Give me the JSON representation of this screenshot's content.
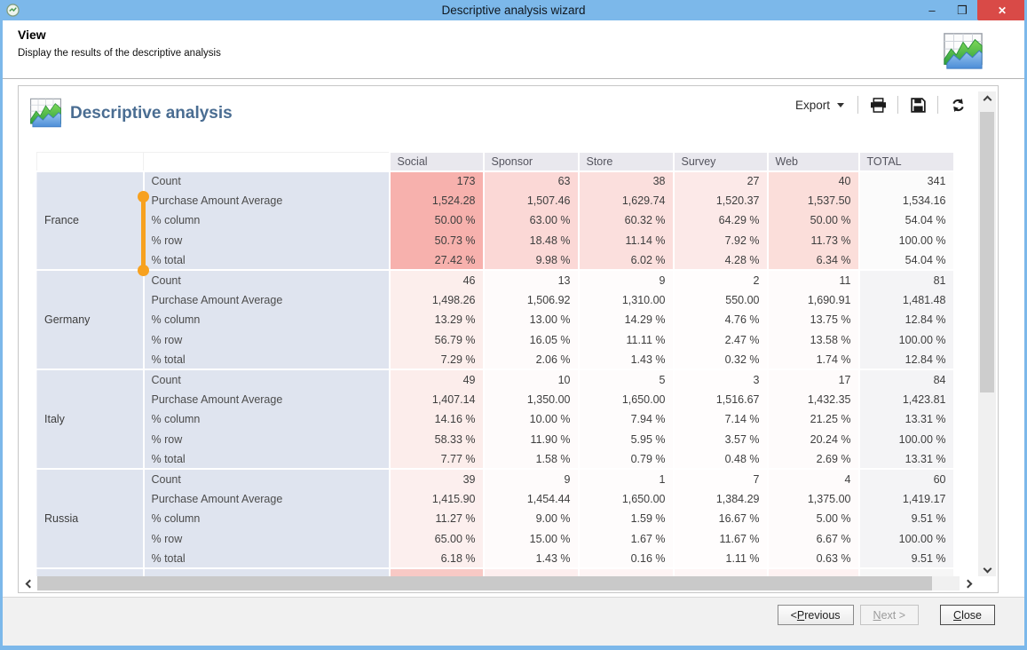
{
  "window": {
    "title": "Descriptive analysis wizard",
    "minimize_glyph": "–",
    "maximize_glyph": "❒",
    "close_glyph": "✕"
  },
  "header": {
    "title": "View",
    "subtitle": "Display the results of the descriptive analysis"
  },
  "panel": {
    "title": "Descriptive analysis",
    "toolbar": {
      "export_label": "Export"
    }
  },
  "icons": {
    "app": "chart-table-icon",
    "toolbar": [
      "export-caret-icon",
      "printer-icon",
      "save-icon",
      "refresh-icon"
    ]
  },
  "colors": {
    "titlebar": "#7cb8ea",
    "close_button": "#d94a47",
    "heading": "#4a6d92",
    "header_cell_bg": "#e9e8ee",
    "row_label_bg": "#dfe4ef",
    "marker_orange": "#f7a11f",
    "footer_bg": "#f1f1f1"
  },
  "table": {
    "column_headers": [
      "Social",
      "Sponsor",
      "Store",
      "Survey",
      "Web",
      "TOTAL"
    ],
    "metric_labels": [
      "Count",
      "Purchase Amount Average",
      "% column",
      "% row",
      "% total"
    ],
    "blocks": [
      {
        "country": "France",
        "tints": [
          "#f7b1ad",
          "#fbd8d6",
          "#fbdfdd",
          "#fce9e8",
          "#fbdeda",
          "#fbfbfb"
        ],
        "rows": [
          {
            "label": "Count",
            "values": [
              "173",
              "63",
              "38",
              "27",
              "40",
              "341"
            ]
          },
          {
            "label": "Purchase Amount Average",
            "values": [
              "1,524.28",
              "1,507.46",
              "1,629.74",
              "1,520.37",
              "1,537.50",
              "1,534.16"
            ]
          },
          {
            "label": "% column",
            "values": [
              "50.00 %",
              "63.00 %",
              "60.32 %",
              "64.29 %",
              "50.00 %",
              "54.04 %"
            ]
          },
          {
            "label": "% row",
            "values": [
              "50.73 %",
              "18.48 %",
              "11.14 %",
              "7.92 %",
              "11.73 %",
              "100.00 %"
            ]
          },
          {
            "label": "% total",
            "values": [
              "27.42 %",
              "9.98 %",
              "6.02 %",
              "4.28 %",
              "6.34 %",
              "54.04 %"
            ]
          }
        ]
      },
      {
        "country": "Germany",
        "tints": [
          "#fceeec",
          "#fefbfb",
          "#fefcfc",
          "#fffdfd",
          "#fefbfb",
          "#f4f4f6"
        ],
        "rows": [
          {
            "label": "Count",
            "values": [
              "46",
              "13",
              "9",
              "2",
              "11",
              "81"
            ]
          },
          {
            "label": "Purchase Amount Average",
            "values": [
              "1,498.26",
              "1,506.92",
              "1,310.00",
              "550.00",
              "1,690.91",
              "1,481.48"
            ]
          },
          {
            "label": "% column",
            "values": [
              "13.29 %",
              "13.00 %",
              "14.29 %",
              "4.76 %",
              "13.75 %",
              "12.84 %"
            ]
          },
          {
            "label": "% row",
            "values": [
              "56.79 %",
              "16.05 %",
              "11.11 %",
              "2.47 %",
              "13.58 %",
              "100.00 %"
            ]
          },
          {
            "label": "% total",
            "values": [
              "7.29 %",
              "2.06 %",
              "1.43 %",
              "0.32 %",
              "1.74 %",
              "12.84 %"
            ]
          }
        ]
      },
      {
        "country": "Italy",
        "tints": [
          "#fcedeb",
          "#fefbfb",
          "#fefcfc",
          "#fffdfd",
          "#fefbfb",
          "#f4f4f6"
        ],
        "rows": [
          {
            "label": "Count",
            "values": [
              "49",
              "10",
              "5",
              "3",
              "17",
              "84"
            ]
          },
          {
            "label": "Purchase Amount Average",
            "values": [
              "1,407.14",
              "1,350.00",
              "1,650.00",
              "1,516.67",
              "1,432.35",
              "1,423.81"
            ]
          },
          {
            "label": "% column",
            "values": [
              "14.16 %",
              "10.00 %",
              "7.94 %",
              "7.14 %",
              "21.25 %",
              "13.31 %"
            ]
          },
          {
            "label": "% row",
            "values": [
              "58.33 %",
              "11.90 %",
              "5.95 %",
              "3.57 %",
              "20.24 %",
              "100.00 %"
            ]
          },
          {
            "label": "% total",
            "values": [
              "7.77 %",
              "1.58 %",
              "0.79 %",
              "0.48 %",
              "2.69 %",
              "13.31 %"
            ]
          }
        ]
      },
      {
        "country": "Russia",
        "tints": [
          "#fcefee",
          "#fefbfb",
          "#fefcfc",
          "#fffdfd",
          "#fefbfb",
          "#f4f4f6"
        ],
        "rows": [
          {
            "label": "Count",
            "values": [
              "39",
              "9",
              "1",
              "7",
              "4",
              "60"
            ]
          },
          {
            "label": "Purchase Amount Average",
            "values": [
              "1,415.90",
              "1,454.44",
              "1,650.00",
              "1,384.29",
              "1,375.00",
              "1,419.17"
            ]
          },
          {
            "label": "% column",
            "values": [
              "11.27 %",
              "9.00 %",
              "1.59 %",
              "16.67 %",
              "5.00 %",
              "9.51 %"
            ]
          },
          {
            "label": "% row",
            "values": [
              "65.00 %",
              "15.00 %",
              "1.67 %",
              "11.67 %",
              "6.67 %",
              "100.00 %"
            ]
          },
          {
            "label": "% total",
            "values": [
              "6.18 %",
              "1.43 %",
              "0.16 %",
              "1.11 %",
              "0.63 %",
              "9.51 %"
            ]
          }
        ]
      }
    ],
    "partial_block": {
      "tints": [
        "#f8c9c5",
        "#fdeeee",
        "#fef4f4",
        "#fef6f6",
        "#fef2f2",
        "#f6f6f6"
      ]
    }
  },
  "footer": {
    "previous": {
      "pre": "< ",
      "key": "P",
      "rest": "revious"
    },
    "next": {
      "pre": "",
      "key": "N",
      "rest": "ext >"
    },
    "close": {
      "pre": "",
      "key": "C",
      "rest": "lose"
    }
  }
}
